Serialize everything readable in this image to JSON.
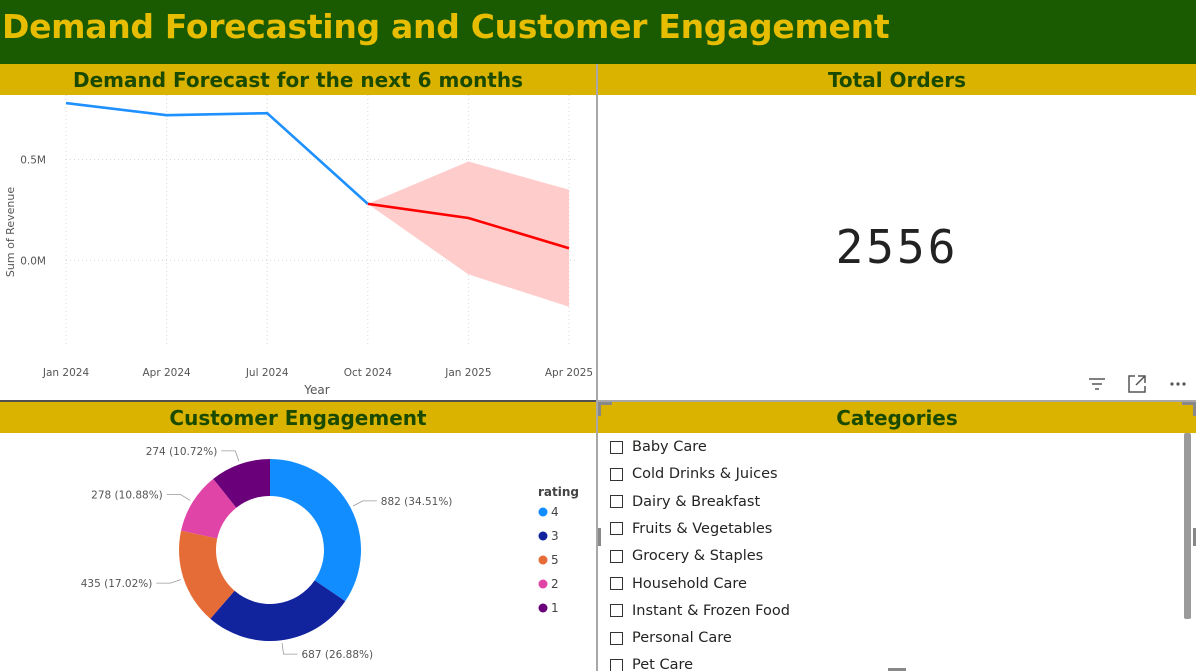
{
  "report": {
    "title": "Demand Forecasting and Customer Engagement"
  },
  "colors": {
    "banner": "#1a5a00",
    "title": "#e6bd00",
    "header": "#dab200",
    "header_text": "#1a4a00"
  },
  "forecast_panel": {
    "header": "Demand Forecast for the next 6 months"
  },
  "orders_panel": {
    "header": "Total Orders",
    "value": "2556"
  },
  "engagement_panel": {
    "header": "Customer Engagement"
  },
  "categories_panel": {
    "header": "Categories",
    "items": [
      "Baby Care",
      "Cold Drinks & Juices",
      "Dairy & Breakfast",
      "Fruits & Vegetables",
      "Grocery & Staples",
      "Household Care",
      "Instant & Frozen Food",
      "Personal Care",
      "Pet Care"
    ]
  },
  "icons": {
    "filter": "filter-icon",
    "focus": "focus-mode-icon",
    "more": "more-options-icon"
  },
  "chart_data": [
    {
      "type": "line",
      "title": "Demand Forecast for the next 6 months",
      "xlabel": "Year",
      "ylabel": "Sum of Revenue",
      "x_ticks": [
        "Jan 2024",
        "Apr 2024",
        "Jul 2024",
        "Oct 2024",
        "Jan 2025",
        "Apr 2025"
      ],
      "y_ticks": [
        "0.0M",
        "0.5M"
      ],
      "ylim": [
        -0.42,
        0.82
      ],
      "grid": true,
      "series": [
        {
          "role": "actual",
          "color": "#1e90ff",
          "points": [
            [
              "2024-01",
              0.78
            ],
            [
              "2024-04",
              0.72
            ],
            [
              "2024-07",
              0.73
            ],
            [
              "2024-10",
              0.28
            ]
          ]
        },
        {
          "role": "forecast",
          "color": "#ff0000",
          "points": [
            [
              "2024-10",
              0.28
            ],
            [
              "2025-01",
              0.21
            ],
            [
              "2025-04",
              0.06
            ]
          ]
        }
      ],
      "confidence_band": {
        "color": "#ffcccc",
        "upper": [
          [
            "2024-10",
            0.28
          ],
          [
            "2025-01",
            0.49
          ],
          [
            "2025-04",
            0.35
          ]
        ],
        "lower": [
          [
            "2024-10",
            0.28
          ],
          [
            "2025-01",
            -0.07
          ],
          [
            "2025-04",
            -0.23
          ]
        ]
      }
    },
    {
      "type": "pie",
      "title": "Customer Engagement",
      "legend_title": "rating",
      "legend_position": "right",
      "slices": [
        {
          "name": "4",
          "value": 882,
          "label": "882 (34.51%)",
          "color": "#118dff"
        },
        {
          "name": "3",
          "value": 687,
          "label": "687 (26.88%)",
          "color": "#12239e"
        },
        {
          "name": "5",
          "value": 435,
          "label": "435 (17.02%)",
          "color": "#e66c37"
        },
        {
          "name": "2",
          "value": 278,
          "label": "278 (10.88%)",
          "color": "#e044a7"
        },
        {
          "name": "1",
          "value": 274,
          "label": "274 (10.72%)",
          "color": "#6b007b"
        }
      ]
    }
  ]
}
